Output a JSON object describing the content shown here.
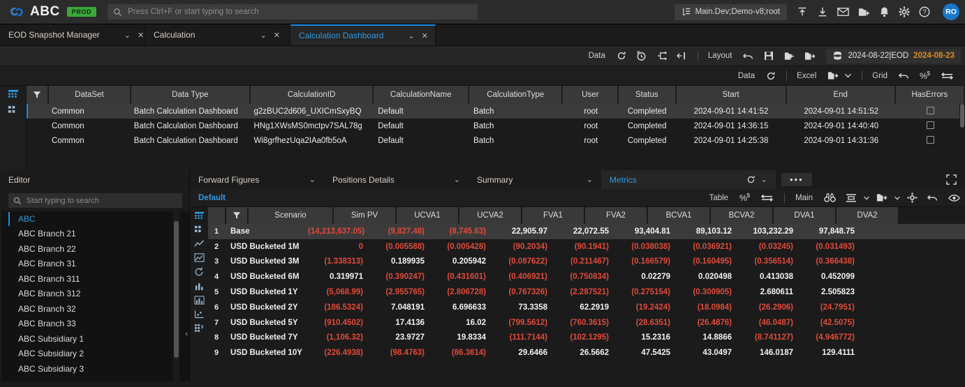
{
  "header": {
    "brand": "ABC",
    "env_badge": "PROD",
    "search_placeholder": "Press Ctrl+F or start typing to search",
    "context": "Main.Dev;Demo-v8;root",
    "avatar_initials": "RO",
    "icons": [
      "upload-icon",
      "download-icon",
      "mail-icon",
      "folder-add-icon",
      "bell-icon",
      "gear-icon",
      "help-icon"
    ]
  },
  "tabs": [
    {
      "label": "EOD Snapshot Manager",
      "active": false
    },
    {
      "label": "Calculation",
      "active": false
    },
    {
      "label": "Calculation Dashboard",
      "active": true
    }
  ],
  "data_toolbar": {
    "data_label": "Data",
    "layout_label": "Layout",
    "date_left": "2024-08-22|EOD",
    "date_right": "2024-08-23"
  },
  "grid_toolbar": {
    "data_label": "Data",
    "excel_label": "Excel",
    "grid_label": "Grid"
  },
  "top_table": {
    "columns": [
      "DataSet",
      "Data Type",
      "CalculationID",
      "CalculationName",
      "CalculationType",
      "User",
      "Status",
      "Start",
      "End",
      "HasErrors"
    ],
    "rows": [
      {
        "selected": true,
        "DataSet": "Common",
        "Data Type": "Batch Calculation Dashboard",
        "CalculationID": "g2zBUC2d606_UXICmSxyBQ",
        "CalculationName": "Default",
        "CalculationType": "Batch",
        "User": "root",
        "Status": "Completed",
        "Start": "2024-09-01 14:41:52",
        "End": "2024-09-01 14:51:52",
        "HasErrors": false
      },
      {
        "selected": false,
        "DataSet": "Common",
        "Data Type": "Batch Calculation Dashboard",
        "CalculationID": "HNg1XWsMS0mctpv7SAL78g",
        "CalculationName": "Default",
        "CalculationType": "Batch",
        "User": "root",
        "Status": "Completed",
        "Start": "2024-09-01 14:36:15",
        "End": "2024-09-01 14:40:40",
        "HasErrors": false
      },
      {
        "selected": false,
        "DataSet": "Common",
        "Data Type": "Batch Calculation Dashboard",
        "CalculationID": "Wi8grfhezUqa2IAa0fb5oA",
        "CalculationName": "Default",
        "CalculationType": "Batch",
        "User": "root",
        "Status": "Completed",
        "Start": "2024-09-01 14:25:38",
        "End": "2024-09-01 14:31:36",
        "HasErrors": false
      }
    ]
  },
  "editor": {
    "title": "Editor",
    "search_placeholder": "Start typing to search",
    "tree": [
      {
        "label": "ABC",
        "selected": true
      },
      {
        "label": "ABC Branch 21",
        "selected": false
      },
      {
        "label": "ABC Branch 22",
        "selected": false
      },
      {
        "label": "ABC Branch 31",
        "selected": false
      },
      {
        "label": "ABC Branch 311",
        "selected": false
      },
      {
        "label": "ABC Branch 312",
        "selected": false
      },
      {
        "label": "ABC Branch 32",
        "selected": false
      },
      {
        "label": "ABC Branch 33",
        "selected": false
      },
      {
        "label": "ABC Subsidiary 1",
        "selected": false
      },
      {
        "label": "ABC Subsidiary 2",
        "selected": false
      },
      {
        "label": "ABC Subsidiary 3",
        "selected": false
      }
    ]
  },
  "subtabs": [
    {
      "label": "Forward Figures",
      "active": false
    },
    {
      "label": "Positions Details",
      "active": false
    },
    {
      "label": "Summary",
      "active": false
    },
    {
      "label": "Metrics",
      "active": true
    }
  ],
  "metrics_toolbar": {
    "default_label": "Default",
    "table_label": "Table",
    "main_label": "Main"
  },
  "metrics": {
    "columns": [
      "Scenario",
      "Sim PV",
      "UCVA1",
      "UCVA2",
      "FVA1",
      "FVA2",
      "BCVA1",
      "BCVA2",
      "DVA1",
      "DVA2"
    ],
    "rows": [
      {
        "n": "1",
        "selected": true,
        "Scenario": "Base",
        "values": [
          "(14,213,637.05)",
          "(9,827.48)",
          "(8,745.63)",
          "22,905.97",
          "22,072.55",
          "93,404.81",
          "89,103.12",
          "103,232.29",
          "97,848.75"
        ],
        "neg": [
          true,
          true,
          true,
          false,
          false,
          false,
          false,
          false,
          false
        ]
      },
      {
        "n": "2",
        "selected": false,
        "Scenario": "USD Bucketed 1M",
        "values": [
          "0",
          "(0.005588)",
          "(0.005428)",
          "(90.2034)",
          "(90.1941)",
          "(0.038038)",
          "(0.036921)",
          "(0.03245)",
          "(0.031493)"
        ],
        "neg": [
          true,
          true,
          true,
          true,
          true,
          true,
          true,
          true,
          true
        ]
      },
      {
        "n": "3",
        "selected": false,
        "Scenario": "USD Bucketed 3M",
        "values": [
          "(1.338313)",
          "0.189935",
          "0.205942",
          "(0.087622)",
          "(0.211467)",
          "(0.166579)",
          "(0.160495)",
          "(0.356514)",
          "(0.366438)"
        ],
        "neg": [
          true,
          false,
          false,
          true,
          true,
          true,
          true,
          true,
          true
        ]
      },
      {
        "n": "4",
        "selected": false,
        "Scenario": "USD Bucketed 6M",
        "values": [
          "0.319971",
          "(0.390247)",
          "(0.431601)",
          "(0.406921)",
          "(0.750834)",
          "0.02279",
          "0.020498",
          "0.413038",
          "0.452099"
        ],
        "neg": [
          false,
          true,
          true,
          true,
          true,
          false,
          false,
          false,
          false
        ]
      },
      {
        "n": "5",
        "selected": false,
        "Scenario": "USD Bucketed 1Y",
        "values": [
          "(5,068.99)",
          "(2.955765)",
          "(2.806728)",
          "(0.767326)",
          "(2.287521)",
          "(0.275154)",
          "(0.300905)",
          "2.680611",
          "2.505823"
        ],
        "neg": [
          true,
          true,
          true,
          true,
          true,
          true,
          true,
          false,
          false
        ]
      },
      {
        "n": "6",
        "selected": false,
        "Scenario": "USD Bucketed 2Y",
        "values": [
          "(186.5324)",
          "7.048191",
          "6.696633",
          "73.3358",
          "62.2919",
          "(19.2424)",
          "(18.0984)",
          "(26.2906)",
          "(24.7951)"
        ],
        "neg": [
          true,
          false,
          false,
          false,
          false,
          true,
          true,
          true,
          true
        ]
      },
      {
        "n": "7",
        "selected": false,
        "Scenario": "USD Bucketed 5Y",
        "values": [
          "(910.4502)",
          "17.4136",
          "16.02",
          "(799.5612)",
          "(760.3615)",
          "(28.6351)",
          "(26.4876)",
          "(46.0487)",
          "(42.5075)"
        ],
        "neg": [
          true,
          false,
          false,
          true,
          true,
          true,
          true,
          true,
          true
        ]
      },
      {
        "n": "8",
        "selected": false,
        "Scenario": "USD Bucketed 7Y",
        "values": [
          "(1,106.32)",
          "23.9727",
          "19.8334",
          "(111.7144)",
          "(102.1295)",
          "15.2316",
          "14.8866",
          "(8.741127)",
          "(4.946772)"
        ],
        "neg": [
          true,
          false,
          false,
          true,
          true,
          false,
          false,
          true,
          true
        ]
      },
      {
        "n": "9",
        "selected": false,
        "Scenario": "USD Bucketed 10Y",
        "values": [
          "(226.4938)",
          "(98.4763)",
          "(86.3614)",
          "29.6466",
          "26.5662",
          "47.5425",
          "43.0497",
          "146.0187",
          "129.4111"
        ],
        "neg": [
          true,
          true,
          true,
          false,
          false,
          false,
          false,
          false,
          false
        ]
      }
    ]
  },
  "colors": {
    "accent": "#1a8fe3",
    "negative": "#e04a3a",
    "badge_green": "#3aa83a",
    "date_orange": "#e08a1e"
  }
}
